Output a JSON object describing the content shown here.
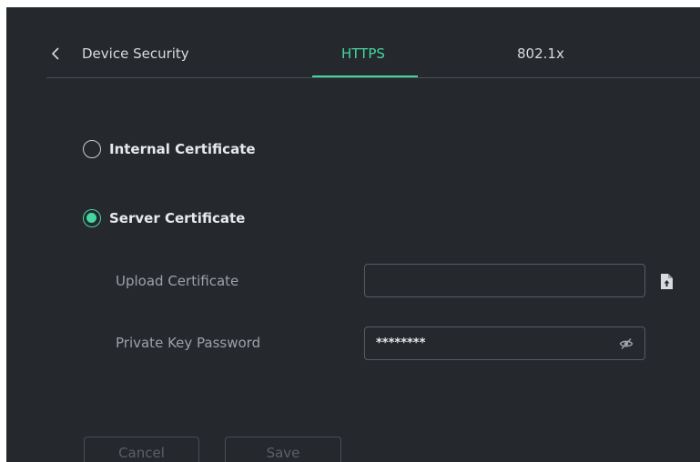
{
  "tabs": {
    "device_security": "Device Security",
    "https": "HTTPS",
    "dot1x": "802.1x",
    "active": "HTTPS"
  },
  "certificate_options": {
    "internal": {
      "label": "Internal Certificate",
      "selected": false
    },
    "server": {
      "label": "Server Certificate",
      "selected": true
    }
  },
  "form": {
    "upload_certificate": {
      "label": "Upload Certificate",
      "value": ""
    },
    "private_key_password": {
      "label": "Private Key Password",
      "value": "********"
    }
  },
  "buttons": {
    "cancel": "Cancel",
    "save": "Save"
  },
  "icons": {
    "back": "chevron-left-icon",
    "upload": "file-upload-icon",
    "visibility": "eye-off-icon"
  },
  "colors": {
    "background": "#25282d",
    "accent": "#44d7a0",
    "text": "#e8e9eb",
    "muted": "#9ea2a8",
    "border": "#585c63"
  }
}
